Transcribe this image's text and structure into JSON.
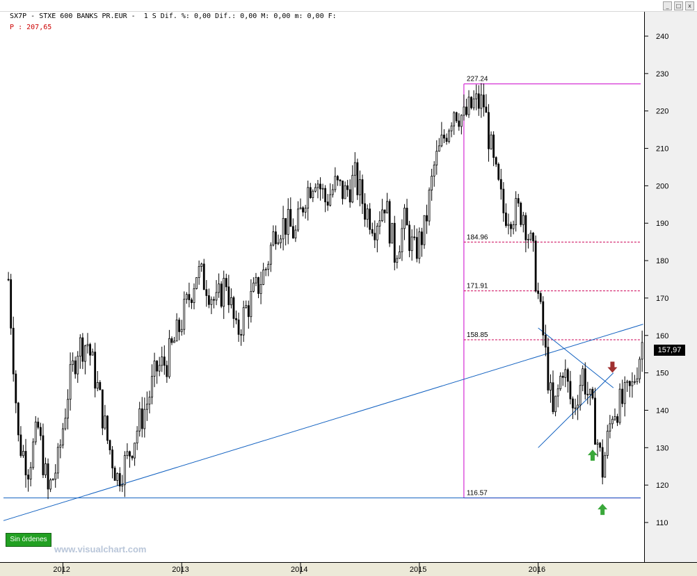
{
  "header": {
    "symbol_line": "SX7P - STXE 600 BANKS PR.EUR -  1 S Dif. %: 0,00 Dif.: 0,00 M: 0,00 m: 0,00 F:",
    "price_text": "P : 207,65"
  },
  "window_controls": [
    "_",
    "□",
    "x"
  ],
  "orders_button": "Sin órdenes",
  "watermark": "www.visualchart.com",
  "last_price_tag": "157,97",
  "colors": {
    "candle": "#000000",
    "trendline": "#1060c0",
    "fib_frame": "#cc00cc",
    "fib_dash": "#cc0055",
    "arrow_up": "#3aa83a",
    "arrow_down": "#a03030"
  },
  "chart_data": {
    "type": "candlestick",
    "y_axis_ticks": [
      110,
      120,
      130,
      140,
      150,
      160,
      170,
      180,
      190,
      200,
      210,
      220,
      230,
      240
    ],
    "x_axis_ticks": [
      "2012",
      "2013",
      "2014",
      "2015",
      "2016"
    ],
    "ylim": [
      104,
      247
    ],
    "x_range": [
      "2011-07",
      "2016-11"
    ],
    "fib_levels": [
      {
        "label": "227.24",
        "value": 227.24
      },
      {
        "label": "184.96",
        "value": 184.96
      },
      {
        "label": "171.91",
        "value": 171.91
      },
      {
        "label": "158.85",
        "value": 158.85
      },
      {
        "label": "116.57",
        "value": 116.57
      }
    ],
    "horizontal_support": 116.57,
    "trendlines": [
      {
        "from": [
          "2011-07",
          110.5
        ],
        "to": [
          "2016-11",
          163.0
        ]
      },
      {
        "from": [
          "2016-01",
          162.0
        ],
        "to": [
          "2016-08",
          146.0
        ]
      },
      {
        "from": [
          "2016-01",
          130.0
        ],
        "to": [
          "2016-08",
          150.0
        ]
      }
    ],
    "signals": [
      {
        "type": "buy",
        "date": "2016-06",
        "value": 128.0
      },
      {
        "type": "buy",
        "date": "2016-07",
        "value": 113.5
      },
      {
        "type": "sell",
        "date": "2016-08",
        "value": 151.5
      }
    ],
    "series_anchor_points": [
      [
        "2011-07",
        175
      ],
      [
        "2011-08",
        132
      ],
      [
        "2011-09",
        125
      ],
      [
        "2011-10",
        135
      ],
      [
        "2011-11",
        118
      ],
      [
        "2011-12",
        126
      ],
      [
        "2012-01",
        145
      ],
      [
        "2012-02",
        157
      ],
      [
        "2012-03",
        158
      ],
      [
        "2012-04",
        146
      ],
      [
        "2012-05",
        132
      ],
      [
        "2012-06",
        122
      ],
      [
        "2012-07",
        127
      ],
      [
        "2012-08",
        135
      ],
      [
        "2012-09",
        142
      ],
      [
        "2012-10",
        151
      ],
      [
        "2012-11",
        153
      ],
      [
        "2012-12",
        160
      ],
      [
        "2013-01",
        168
      ],
      [
        "2013-02",
        177
      ],
      [
        "2013-03",
        174
      ],
      [
        "2013-04",
        168
      ],
      [
        "2013-05",
        175
      ],
      [
        "2013-06",
        160
      ],
      [
        "2013-07",
        167
      ],
      [
        "2013-08",
        172
      ],
      [
        "2013-09",
        178
      ],
      [
        "2013-10",
        189
      ],
      [
        "2013-11",
        190
      ],
      [
        "2013-12",
        187
      ],
      [
        "2014-01",
        198
      ],
      [
        "2014-02",
        203
      ],
      [
        "2014-03",
        196
      ],
      [
        "2014-04",
        200
      ],
      [
        "2014-05",
        198
      ],
      [
        "2014-06",
        202
      ],
      [
        "2014-07",
        194
      ],
      [
        "2014-08",
        190
      ],
      [
        "2014-09",
        196
      ],
      [
        "2014-10",
        182
      ],
      [
        "2014-11",
        190
      ],
      [
        "2014-12",
        182
      ],
      [
        "2015-01",
        188
      ],
      [
        "2015-02",
        205
      ],
      [
        "2015-03",
        213
      ],
      [
        "2015-04",
        221
      ],
      [
        "2015-05",
        218
      ],
      [
        "2015-06",
        222
      ],
      [
        "2015-07",
        222
      ],
      [
        "2015-08",
        205
      ],
      [
        "2015-09",
        193
      ],
      [
        "2015-10",
        193
      ],
      [
        "2015-11",
        193
      ],
      [
        "2015-12",
        181
      ],
      [
        "2016-01",
        160
      ],
      [
        "2016-02",
        138
      ],
      [
        "2016-03",
        152
      ],
      [
        "2016-04",
        140
      ],
      [
        "2016-05",
        150
      ],
      [
        "2016-06",
        139
      ],
      [
        "2016-07",
        124
      ],
      [
        "2016-08",
        140
      ],
      [
        "2016-09",
        142
      ],
      [
        "2016-10",
        146
      ],
      [
        "2016-11",
        158
      ]
    ]
  }
}
